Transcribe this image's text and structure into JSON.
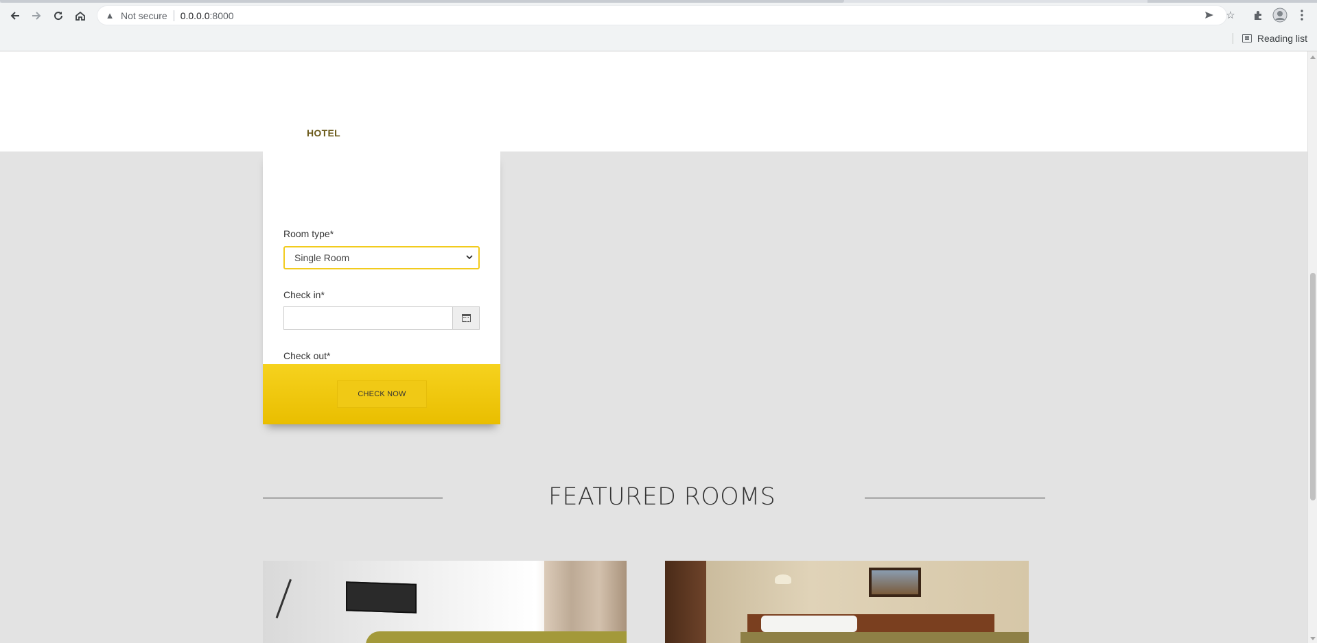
{
  "browser": {
    "security_label": "Not secure",
    "url_host": "0.0.0.0",
    "url_port": ":8000",
    "reading_list_label": "Reading list",
    "icons": [
      "back-icon",
      "forward-icon",
      "reload-icon",
      "home-icon",
      "warning-icon",
      "send-icon",
      "star-icon",
      "extensions-icon",
      "profile-icon",
      "menu-icon",
      "reading-list-icon"
    ]
  },
  "site": {
    "logo": "HOTEL"
  },
  "booking": {
    "room_type_label": "Room type*",
    "room_type_value": "Single Room",
    "checkin_label": "Check in*",
    "checkout_label": "Check out*",
    "submit_label": "CHECK NOW",
    "accent_color": "#f2cb1d"
  },
  "featured": {
    "title": "FEATURED ROOMS"
  }
}
